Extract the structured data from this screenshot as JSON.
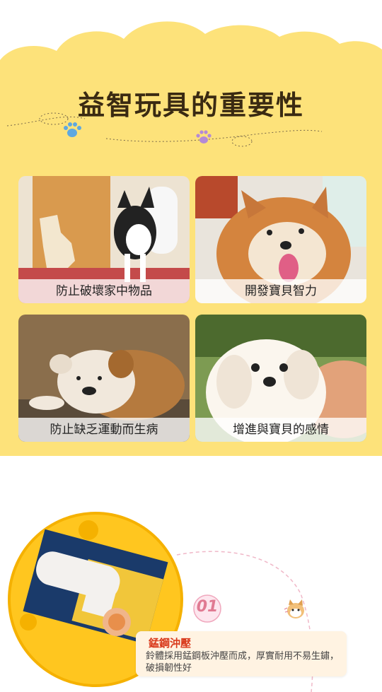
{
  "section_title": "益智玩具的重要性",
  "cards": [
    {
      "caption": "防止破壞家中物品",
      "subject": "boston-terrier-chewed-door"
    },
    {
      "caption": "開發寶貝智力",
      "subject": "shiba-inu-smiling"
    },
    {
      "caption": "防止缺乏運動而生病",
      "subject": "bulldog-lying"
    },
    {
      "caption": "增進與寶貝的感情",
      "subject": "maltese-on-arm"
    }
  ],
  "feature": {
    "number": "01",
    "title": "錳鋼沖壓",
    "description": "鈴體採用錳鋼板沖壓而成，厚實耐用不易生鏽，破損韌性好"
  },
  "colors": {
    "yellow": "#fde27a",
    "title": "#3a2a12",
    "feature_title": "#d93a1c",
    "badge": "#e07a92",
    "feature_bg": "#fff3e2"
  },
  "icons": [
    "paw-icon-blue",
    "paw-icon-purple",
    "shiba-mascot-icon"
  ]
}
